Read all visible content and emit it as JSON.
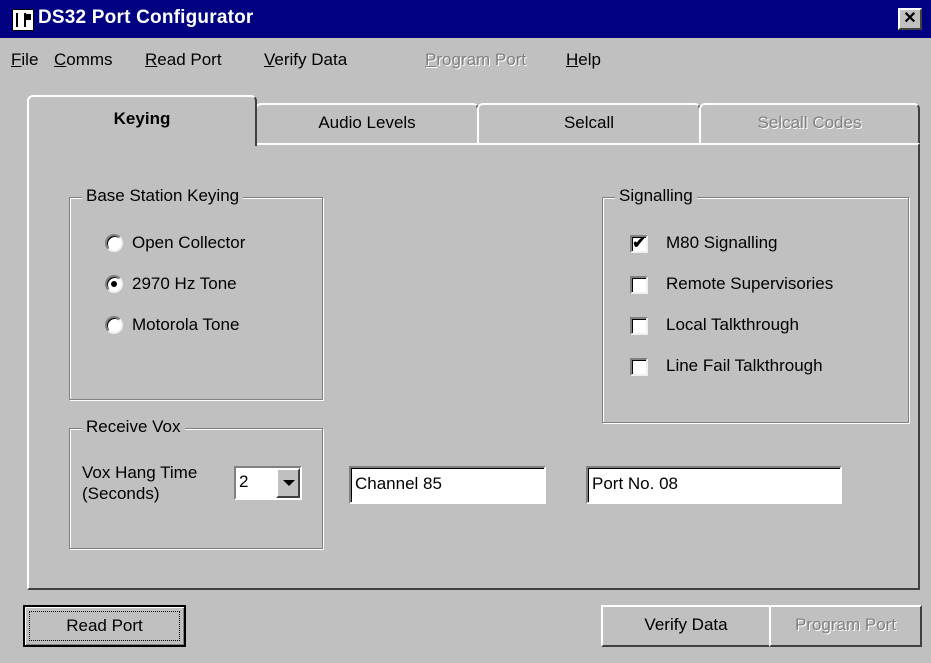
{
  "window": {
    "title": "DS32 Port Configurator",
    "close_glyph": "✕",
    "icon": "app-icon"
  },
  "menu": [
    {
      "label": "File",
      "accel": "F",
      "rest": "ile",
      "enabled": true
    },
    {
      "label": "Comms",
      "accel": "C",
      "rest": "omms",
      "enabled": true
    },
    {
      "label": "Read Port",
      "accel": "R",
      "rest": "ead Port",
      "enabled": true
    },
    {
      "label": "Verify Data",
      "accel": "V",
      "rest": "erify Data",
      "enabled": true
    },
    {
      "label": "Program Port",
      "accel": "P",
      "rest": "rogram Port",
      "enabled": false
    },
    {
      "label": "Help",
      "accel": "H",
      "rest": "elp",
      "enabled": true
    }
  ],
  "tabs": [
    {
      "label": "Keying",
      "active": true,
      "enabled": true
    },
    {
      "label": "Audio Levels",
      "active": false,
      "enabled": true
    },
    {
      "label": "Selcall",
      "active": false,
      "enabled": true
    },
    {
      "label": "Selcall Codes",
      "active": false,
      "enabled": false
    }
  ],
  "keying_group": {
    "label": "Base Station Keying",
    "options": [
      {
        "label": "Open Collector",
        "checked": false
      },
      {
        "label": "2970 Hz Tone",
        "checked": true
      },
      {
        "label": "Motorola Tone",
        "checked": false
      }
    ]
  },
  "signalling_group": {
    "label": "Signalling",
    "options": [
      {
        "label": "M80 Signalling",
        "checked": true,
        "mark": "✔"
      },
      {
        "label": "Remote Supervisories",
        "checked": false,
        "mark": ""
      },
      {
        "label": "Local Talkthrough",
        "checked": false,
        "mark": ""
      },
      {
        "label": "Line Fail Talkthrough",
        "checked": false,
        "mark": ""
      }
    ]
  },
  "vox_group": {
    "label": "Receive Vox",
    "hang_time_label_1": "Vox Hang Time",
    "hang_time_label_2": "(Seconds)",
    "hang_time_value": "2"
  },
  "fields": {
    "channel": "Channel 85",
    "port_no": "Port No. 08"
  },
  "buttons": {
    "read_port": "Read Port",
    "verify_data": "Verify Data",
    "program_port": "Program Port"
  },
  "colors": {
    "titlebar": "#000080",
    "face": "#c0c0c0",
    "disabled_text": "#808080"
  }
}
